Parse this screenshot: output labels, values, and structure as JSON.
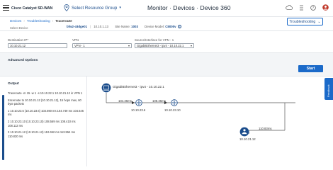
{
  "header": {
    "brand": "Cisco Catalyst SD-WAN",
    "resource_group": "Select Resource Group",
    "page_title": "Monitor · Devices · Device 360"
  },
  "breadcrumb": {
    "items": [
      "Devices",
      "Troubleshooting",
      "Traceroute"
    ]
  },
  "device": {
    "select_label": "Select Device",
    "name": "bfw2-c8dge01",
    "ip": "10.10.1.13",
    "site_label": "Site Name:",
    "site_value": "1003",
    "model_label": "Device Model:",
    "model_value": "C8000v"
  },
  "troubleshooting_button": "Troubleshooting",
  "form": {
    "destination_label": "Destination IP*",
    "destination_value": "10.10.21.12",
    "vpn_label": "VPN",
    "vpn_value": "VPN - 1",
    "source_label": "Source/Interface for VPN - 1",
    "source_value": "GigabitEthernet3 - ipv4 - 10.10.22.1"
  },
  "advanced": {
    "title": "Advanced Options",
    "start_label": "Start"
  },
  "output": {
    "title": "Output",
    "lines": [
      "Traceroute -m 15 -w 1 -s 10.10.22.1 10.10.21.12 in VPN 1",
      "traceroute to 10.10.21.12 (10.10.21.12), 15 hops max, 60 byte packets",
      "1 10.10.23.6 (10.10.23.6) 103.690 ms 104.749 ms 104.646 ms",
      "2 10.10.23.10 (10.10.23.10) 108.569 ms 108.410 ms 108.112 ms",
      "3 10.10.21.12 (10.10.21.12) 110.652 ms 113.554 ms 110.830 ms"
    ]
  },
  "topology": {
    "source_label": "GigabitEthernet3 - ipv4 - 10.10.22.1",
    "hop1_latency": "104.36ms",
    "hop1_ip": "10.10.23.6",
    "hop2_latency": "108.36ms",
    "hop2_ip": "10.10.23.10",
    "dest_latency": "110.83ms",
    "dest_ip": "10.10.21.12"
  },
  "feedback_label": "Feedback",
  "colors": {
    "accent": "#1b6ac9",
    "dark_blue": "#1b4d8c",
    "panel_bg": "#f3f5f7"
  }
}
